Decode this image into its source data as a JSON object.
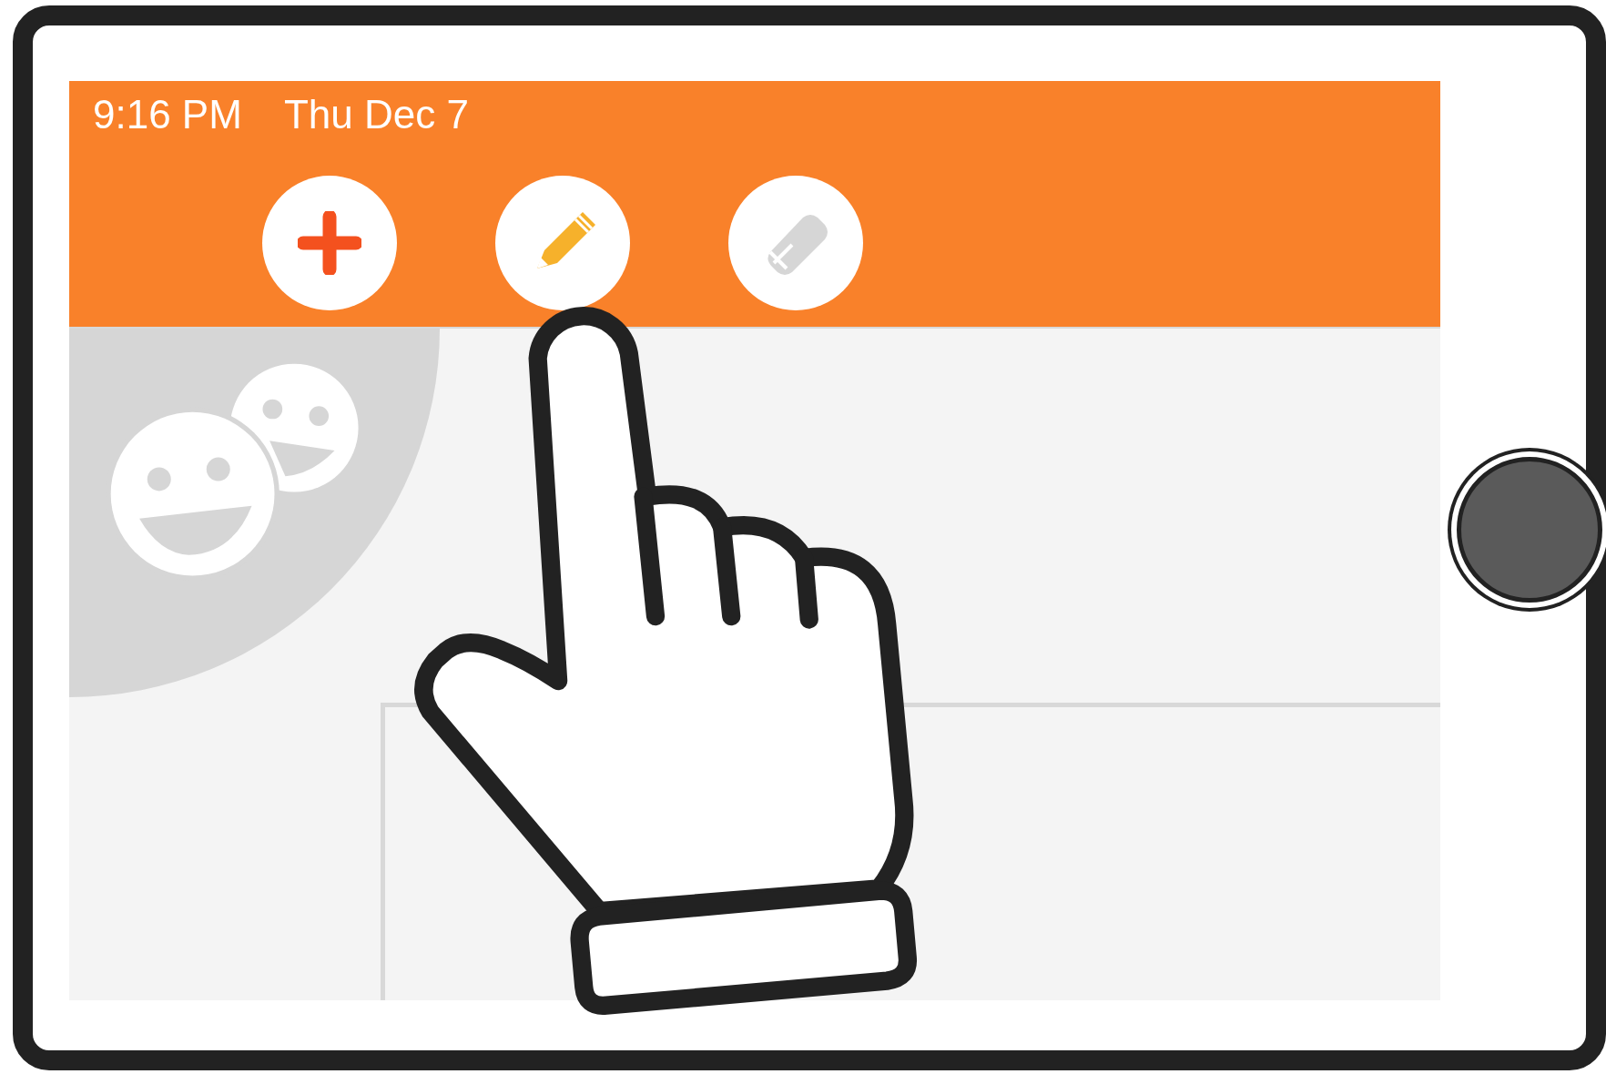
{
  "status_bar": {
    "time": "9:16 PM",
    "date": "Thu Dec 7"
  },
  "toolbar": {
    "buttons": [
      {
        "kind": "add"
      },
      {
        "kind": "pencil"
      },
      {
        "kind": "eraser"
      }
    ]
  }
}
